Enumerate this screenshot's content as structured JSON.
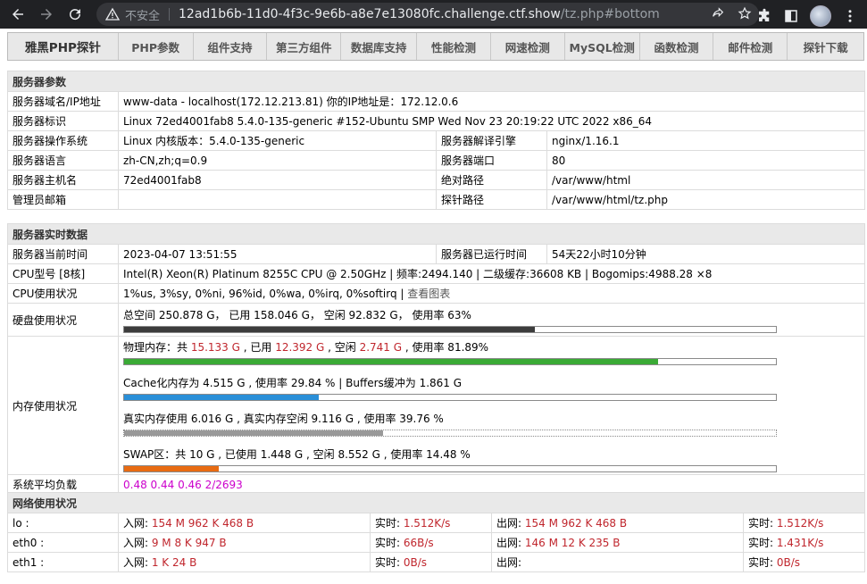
{
  "browser": {
    "insecure_label": "不安全",
    "url_host": "12ad1b6b-11d0-4f3c-9e6b-a8e7e13080fc.challenge.ctf.show",
    "url_path": "/tz.php#bottom"
  },
  "menu": [
    "雅黑PHP探针",
    "PHP参数",
    "组件支持",
    "第三方组件",
    "数据库支持",
    "性能检测",
    "网速检测",
    "MySQL检测",
    "函数检测",
    "邮件检测",
    "探针下载"
  ],
  "server": {
    "title": "服务器参数",
    "domain_label": "服务器域名/IP地址",
    "domain_value": "www-data - localhost(172.12.213.81)  你的IP地址是：172.12.0.6",
    "ident_label": "服务器标识",
    "ident_value": "Linux 72ed4001fab8 5.4.0-135-generic #152-Ubuntu SMP Wed Nov 23 20:19:22 UTC 2022 x86_64",
    "os_label": "服务器操作系统",
    "os_value": "Linux  内核版本：5.4.0-135-generic",
    "engine_label": "服务器解译引擎",
    "engine_value": "nginx/1.16.1",
    "lang_label": "服务器语言",
    "lang_value": "zh-CN,zh;q=0.9",
    "port_label": "服务器端口",
    "port_value": "80",
    "host_label": "服务器主机名",
    "host_value": "72ed4001fab8",
    "abspath_label": "绝对路径",
    "abspath_value": "/var/www/html",
    "admin_label": "管理员邮箱",
    "admin_value": "",
    "probepath_label": "探针路径",
    "probepath_value": "/var/www/html/tz.php"
  },
  "realtime": {
    "title": "服务器实时数据",
    "time_label": "服务器当前时间",
    "time_value": "2023-04-07 13:51:55",
    "uptime_label": "服务器已运行时间",
    "uptime_value": "54天22小时10分钟",
    "cpu_label": "CPU型号 [8核]",
    "cpu_value": "Intel(R) Xeon(R) Platinum 8255C CPU @ 2.50GHz | 频率:2494.140 | 二级缓存:36608 KB | Bogomips:4988.28 ×8",
    "cpuuse_label": "CPU使用状况",
    "cpuuse_value": "1%us, 3%sy, 0%ni, 96%id, 0%wa, 0%irq, 0%softirq | ",
    "cpuuse_link": "查看图表",
    "disk_label": "硬盘使用状况",
    "disk_value": "总空间 250.878 G，  已用 158.046 G，  空闲 92.832 G，  使用率 63%",
    "disk_ratio": 0.63,
    "mem_label": "内存使用状况",
    "phys": {
      "a": "物理内存：共 ",
      "total": "15.133 G",
      "b": " , 已用 ",
      "used": "12.392 G",
      "c": " , 空闲 ",
      "free": "2.741 G",
      "d": " , 使用率 81.89%",
      "ratio": 0.8189
    },
    "cache_value": "Cache化内存为 4.515 G , 使用率 29.84 % | Buffers缓冲为 1.861 G",
    "cache_ratio": 0.2984,
    "real_value": "真实内存使用 6.016 G , 真实内存空闲 9.116 G , 使用率 39.76 %",
    "real_ratio": 0.3976,
    "swap_value": "SWAP区：共 10 G , 已使用 1.448 G , 空闲 8.552 G , 使用率 14.48 %",
    "swap_ratio": 0.1448,
    "load_label": "系统平均负载",
    "load_value": "0.48 0.44 0.46 2/2693"
  },
  "network": {
    "title": "网络使用状况",
    "in_prefix": "入网: ",
    "out_prefix": "出网: ",
    "rt_prefix": "实时: ",
    "rows": [
      {
        "name": "lo :",
        "in": "154 M 962 K 468 B",
        "in_rt": "1.512K/s",
        "out": "154 M 962 K 468 B",
        "out_rt": "1.512K/s"
      },
      {
        "name": "eth0 :",
        "in": "9 M 8 K 947 B",
        "in_rt": "66B/s",
        "out": "146 M 12 K 235 B",
        "out_rt": "1.431K/s"
      },
      {
        "name": "eth1 :",
        "in": "1 K 24 B",
        "in_rt": "0B/s",
        "out": "",
        "out_rt": "0B/s"
      }
    ]
  },
  "colors": {
    "disk": "#3c3c3c",
    "phys": "#3aaa35",
    "cache": "#2a8fd8",
    "real": "#999999",
    "swap": "#e86b12",
    "accent_red": "#c0262d",
    "load": "#cc00cc"
  }
}
